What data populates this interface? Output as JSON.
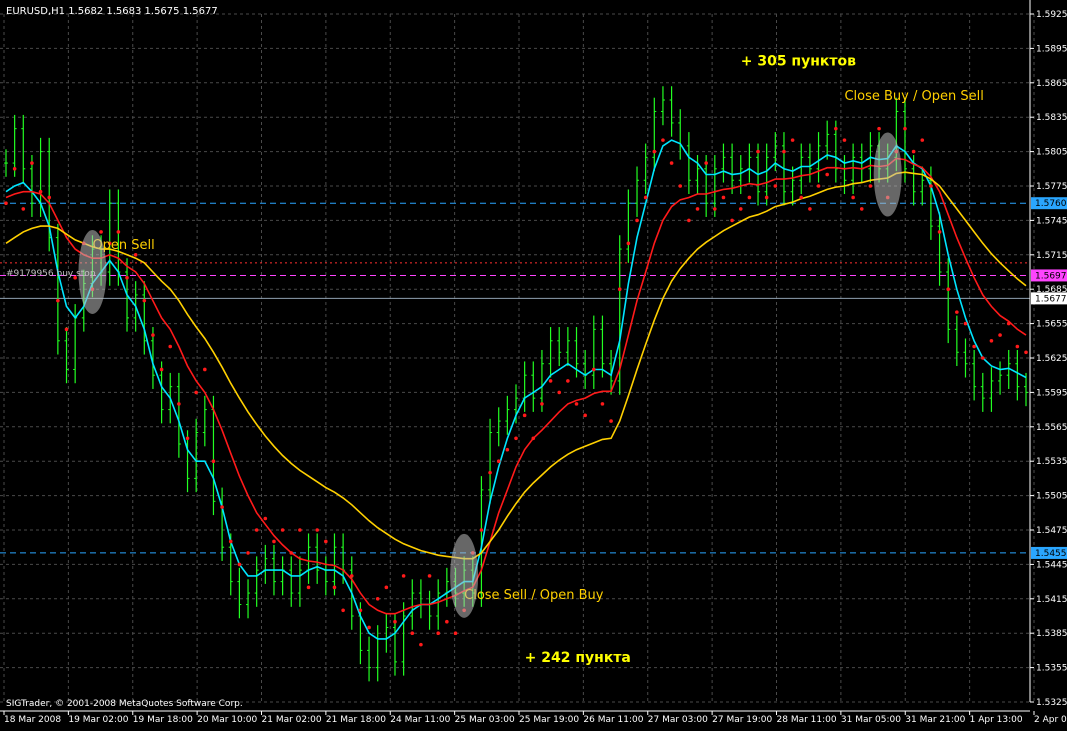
{
  "header": {
    "symbol_line": "EURUSD,H1  1.5682 1.5683 1.5675 1.5677"
  },
  "footer": {
    "copyright": "SIGTrader, © 2001-2008 MetaQuotes Software Corp."
  },
  "order_label": "#9179956 buy stop",
  "colors": {
    "background": "#000000",
    "grid": "#4a4a4a",
    "candles": "#22ff22",
    "ma_fast": "#00e5ff",
    "ma_mid": "#ff1a1a",
    "ma_slow": "#ffd000",
    "parabolic_sar": "#ff1a1a",
    "fractals": "#a0a0a0",
    "annotation_text": "#ffff00",
    "level_blue": "#2aa6ff",
    "level_magenta": "#ff44ff",
    "level_red": "#ff3030"
  },
  "chart_data": {
    "type": "line",
    "ylim": [
      1.5325,
      1.5925
    ],
    "y_ticks": [
      "1.5925",
      "1.5895",
      "1.5865",
      "1.5835",
      "1.5805",
      "1.5775",
      "1.5745",
      "1.5715",
      "1.5685",
      "1.5655",
      "1.5625",
      "1.5595",
      "1.5565",
      "1.5535",
      "1.5505",
      "1.5475",
      "1.5445",
      "1.5415",
      "1.5385",
      "1.5355",
      "1.5325"
    ],
    "x_tick_labels": [
      "18 Mar 2008",
      "19 Mar 02:00",
      "19 Mar 18:00",
      "20 Mar 10:00",
      "21 Mar 02:00",
      "21 Mar 18:00",
      "24 Mar 11:00",
      "25 Mar 03:00",
      "25 Mar 19:00",
      "26 Mar 11:00",
      "27 Mar 03:00",
      "27 Mar 19:00",
      "28 Mar 11:00",
      "31 Mar 05:00",
      "31 Mar 21:00",
      "1 Apr 13:00",
      "2 Apr 05:00"
    ],
    "price_markers": [
      {
        "value": "1.5760",
        "color": "#2aa6ff",
        "text_color": "#000000"
      },
      {
        "value": "1.5697",
        "color": "#ff44ff",
        "text_color": "#000000"
      },
      {
        "value": "1.5677",
        "color": "#ffffff",
        "text_color": "#000000"
      },
      {
        "value": "1.5455",
        "color": "#2aa6ff",
        "text_color": "#000000"
      }
    ],
    "horizontal_levels": [
      {
        "value": 1.576,
        "color": "#2aa6ff",
        "style": "dashed"
      },
      {
        "value": 1.5708,
        "color": "#ff3030",
        "style": "dotted"
      },
      {
        "value": 1.5697,
        "color": "#ff44ff",
        "style": "dashed"
      },
      {
        "value": 1.5677,
        "color": "#8fa0b0",
        "style": "solid"
      },
      {
        "value": 1.5455,
        "color": "#2aa6ff",
        "style": "dashed"
      }
    ],
    "series": [
      {
        "name": "",
        "color": "#22ff22",
        "kind": "close",
        "values": [
          1.5795,
          1.5825,
          1.579,
          1.576,
          1.5805,
          1.573,
          1.564,
          1.5615,
          1.566,
          1.569,
          1.572,
          1.57,
          1.576,
          1.57,
          1.566,
          1.568,
          1.564,
          1.561,
          1.558,
          1.56,
          1.555,
          1.552,
          1.556,
          1.558,
          1.55,
          1.546,
          1.543,
          1.541,
          1.542,
          1.544,
          1.545,
          1.543,
          1.544,
          1.542,
          1.544,
          1.546,
          1.544,
          1.543,
          1.546,
          1.544,
          1.54,
          1.537,
          1.5355,
          1.538,
          1.539,
          1.536,
          1.54,
          1.542,
          1.541,
          1.54,
          1.542,
          1.543,
          1.542,
          1.544,
          1.542,
          1.551,
          1.556,
          1.557,
          1.558,
          1.559,
          1.561,
          1.559,
          1.562,
          1.564,
          1.563,
          1.564,
          1.562,
          1.561,
          1.565,
          1.562,
          1.5605,
          1.572,
          1.576,
          1.578,
          1.58,
          1.584,
          1.585,
          1.583,
          1.581,
          1.578,
          1.579,
          1.576,
          1.579,
          1.58,
          1.578,
          1.579,
          1.58,
          1.577,
          1.58,
          1.581,
          1.577,
          1.578,
          1.58,
          1.579,
          1.581,
          1.582,
          1.579,
          1.578,
          1.58,
          1.579,
          1.581,
          1.579,
          1.58,
          1.584,
          1.579,
          1.577,
          1.578,
          1.574,
          1.57,
          1.565,
          1.563,
          1.562,
          1.56,
          1.559,
          1.5605,
          1.561,
          1.562,
          1.56,
          1.5595
        ]
      },
      {
        "name": "",
        "color": "#00e5ff",
        "kind": "ma",
        "values": [
          1.577,
          1.5775,
          1.5778,
          1.577,
          1.576,
          1.574,
          1.57,
          1.567,
          1.566,
          1.567,
          1.569,
          1.57,
          1.571,
          1.57,
          1.568,
          1.567,
          1.565,
          1.562,
          1.56,
          1.559,
          1.557,
          1.5545,
          1.5535,
          1.5535,
          1.552,
          1.5495,
          1.5465,
          1.5445,
          1.5435,
          1.5435,
          1.544,
          1.544,
          1.544,
          1.5435,
          1.5435,
          1.544,
          1.5443,
          1.544,
          1.544,
          1.5435,
          1.542,
          1.54,
          1.5385,
          1.538,
          1.538,
          1.5385,
          1.5395,
          1.5405,
          1.541,
          1.541,
          1.5415,
          1.542,
          1.5425,
          1.543,
          1.543,
          1.546,
          1.55,
          1.553,
          1.5555,
          1.5575,
          1.559,
          1.5595,
          1.56,
          1.561,
          1.5615,
          1.562,
          1.5615,
          1.561,
          1.5615,
          1.5615,
          1.561,
          1.564,
          1.569,
          1.573,
          1.576,
          1.579,
          1.581,
          1.5815,
          1.5812,
          1.58,
          1.5795,
          1.5785,
          1.5785,
          1.5788,
          1.5785,
          1.5786,
          1.579,
          1.5785,
          1.5788,
          1.5795,
          1.579,
          1.5788,
          1.5792,
          1.5792,
          1.5797,
          1.5802,
          1.58,
          1.5795,
          1.5797,
          1.5795,
          1.58,
          1.5798,
          1.5799,
          1.581,
          1.5805,
          1.5795,
          1.579,
          1.5775,
          1.575,
          1.5715,
          1.5685,
          1.566,
          1.564,
          1.5625,
          1.5618,
          1.5615,
          1.5616,
          1.5612,
          1.5608
        ]
      },
      {
        "name": "",
        "color": "#ff1a1a",
        "kind": "ma",
        "values": [
          1.5765,
          1.5768,
          1.577,
          1.577,
          1.5768,
          1.576,
          1.5745,
          1.573,
          1.572,
          1.5715,
          1.5712,
          1.5712,
          1.5715,
          1.5712,
          1.5705,
          1.57,
          1.569,
          1.5675,
          1.566,
          1.565,
          1.5635,
          1.5618,
          1.5605,
          1.5595,
          1.558,
          1.5562,
          1.5542,
          1.5522,
          1.5505,
          1.549,
          1.548,
          1.547,
          1.5462,
          1.5455,
          1.545,
          1.5448,
          1.5447,
          1.5445,
          1.5444,
          1.544,
          1.5432,
          1.542,
          1.541,
          1.5405,
          1.5402,
          1.5402,
          1.5405,
          1.5408,
          1.541,
          1.541,
          1.5412,
          1.5415,
          1.5418,
          1.5422,
          1.5425,
          1.544,
          1.5465,
          1.549,
          1.551,
          1.553,
          1.5545,
          1.5555,
          1.5562,
          1.557,
          1.5578,
          1.5585,
          1.5588,
          1.559,
          1.5594,
          1.5596,
          1.5596,
          1.5615,
          1.5645,
          1.5675,
          1.57,
          1.5725,
          1.5745,
          1.5757,
          1.5763,
          1.5765,
          1.5768,
          1.5768,
          1.577,
          1.5772,
          1.5773,
          1.5775,
          1.5777,
          1.5776,
          1.5778,
          1.5781,
          1.5781,
          1.5782,
          1.5784,
          1.5785,
          1.5788,
          1.5791,
          1.5791,
          1.579,
          1.5791,
          1.579,
          1.5793,
          1.5792,
          1.5793,
          1.5799,
          1.5798,
          1.5794,
          1.5791,
          1.5783,
          1.577,
          1.575,
          1.573,
          1.5712,
          1.5695,
          1.568,
          1.567,
          1.5662,
          1.5657,
          1.565,
          1.5645
        ]
      },
      {
        "name": "",
        "color": "#ffd000",
        "kind": "ma",
        "values": [
          1.5725,
          1.573,
          1.5735,
          1.5738,
          1.574,
          1.574,
          1.5738,
          1.5733,
          1.5728,
          1.5725,
          1.5722,
          1.572,
          1.572,
          1.5718,
          1.5715,
          1.5712,
          1.5708,
          1.57,
          1.5692,
          1.5685,
          1.5675,
          1.5663,
          1.5652,
          1.5642,
          1.563,
          1.5617,
          1.5603,
          1.559,
          1.5578,
          1.5567,
          1.5557,
          1.5548,
          1.554,
          1.5533,
          1.5527,
          1.5522,
          1.5517,
          1.5512,
          1.5508,
          1.5503,
          1.5497,
          1.549,
          1.5483,
          1.5477,
          1.5472,
          1.5467,
          1.5463,
          1.546,
          1.5457,
          1.5455,
          1.5453,
          1.5452,
          1.5451,
          1.545,
          1.545,
          1.5455,
          1.5465,
          1.5475,
          1.5487,
          1.5498,
          1.5508,
          1.5516,
          1.5523,
          1.553,
          1.5536,
          1.5541,
          1.5545,
          1.5548,
          1.5551,
          1.5554,
          1.5555,
          1.557,
          1.5592,
          1.5615,
          1.5637,
          1.5658,
          1.5677,
          1.5692,
          1.5703,
          1.5712,
          1.572,
          1.5726,
          1.5731,
          1.5736,
          1.574,
          1.5744,
          1.5748,
          1.575,
          1.5753,
          1.5757,
          1.5759,
          1.5761,
          1.5764,
          1.5766,
          1.5769,
          1.5772,
          1.5774,
          1.5775,
          1.5777,
          1.5778,
          1.578,
          1.5781,
          1.5782,
          1.5786,
          1.5787,
          1.5786,
          1.5785,
          1.5781,
          1.5775,
          1.5765,
          1.5755,
          1.5745,
          1.5735,
          1.5725,
          1.5716,
          1.5708,
          1.5701,
          1.5694,
          1.5688
        ]
      }
    ],
    "annotations": [
      {
        "text": "Open Sell",
        "color": "#ffd000",
        "x": 10,
        "y": 1.572
      },
      {
        "text": "Close Sell / Open Buy",
        "color": "#ffd000",
        "x": 53,
        "y": 1.5415
      },
      {
        "text": "+ 242 пункта",
        "color": "#ffff00",
        "x": 60,
        "y": 1.536,
        "bold": true
      },
      {
        "text": "+ 305 пунктов",
        "color": "#ffff00",
        "x": 85,
        "y": 1.588,
        "bold": true
      },
      {
        "text": "Close Buy / Open Sell",
        "color": "#ffd000",
        "x": 97,
        "y": 1.585
      }
    ]
  }
}
